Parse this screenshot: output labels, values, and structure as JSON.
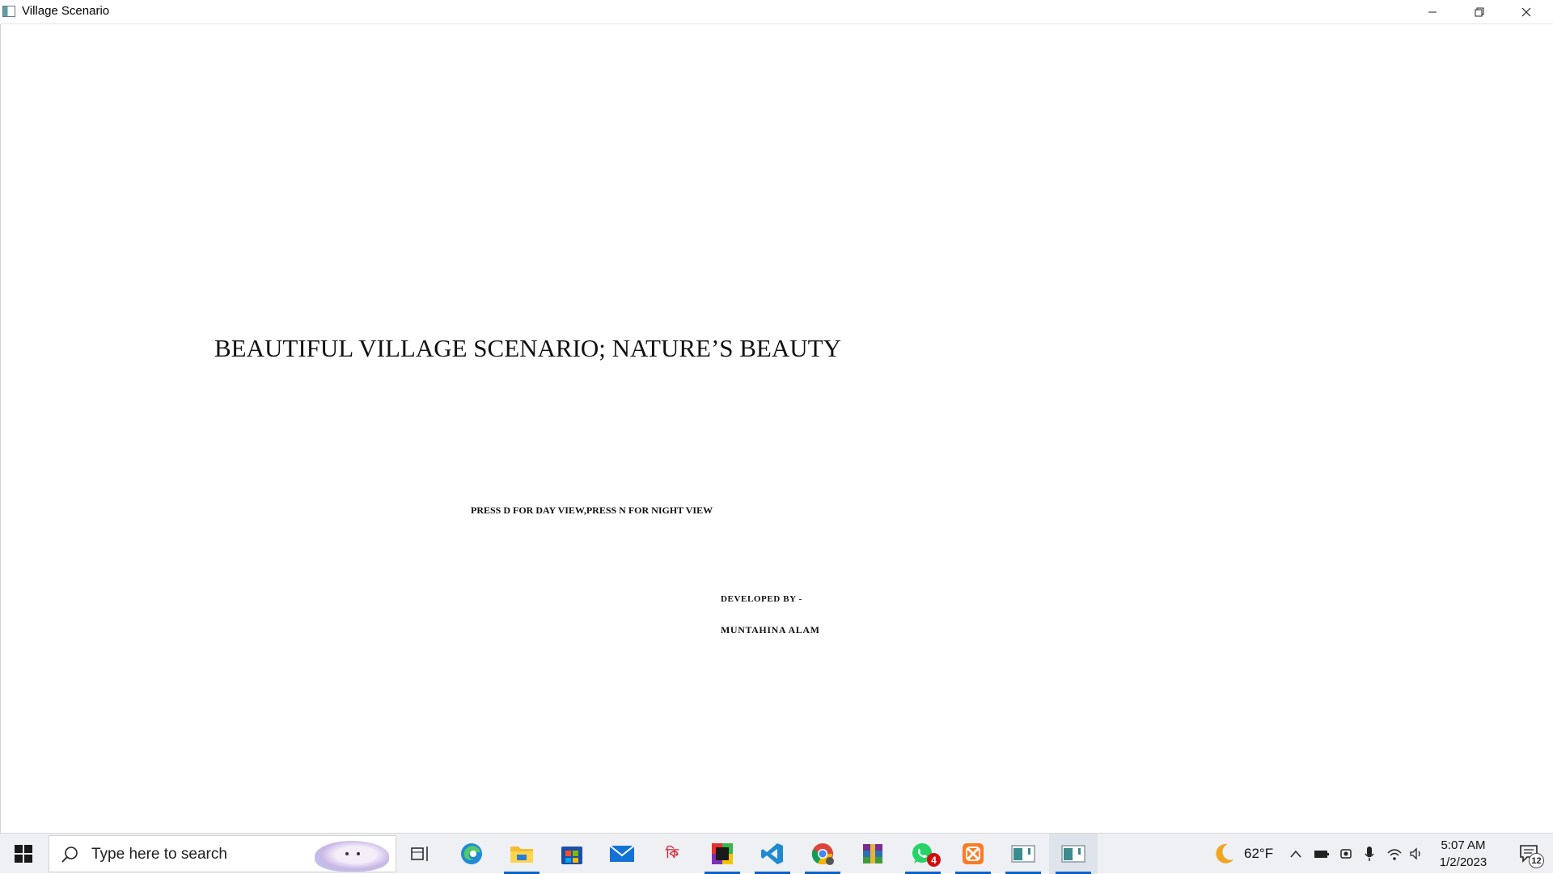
{
  "window": {
    "title": "Village Scenario",
    "icon": "opengl-app-icon"
  },
  "canvas": {
    "main_title": "BEAUTIFUL VILLAGE SCENARIO; NATURE’S BEAUTY",
    "instructions": "PRESS D FOR DAY VIEW,PRESS N FOR NIGHT VIEW",
    "developed_by_label": "DEVELOPED BY -",
    "developer_name": "MUNTAHINA ALAM"
  },
  "taskbar": {
    "search_placeholder": "Type here to search",
    "apps": [
      {
        "name": "task-view",
        "active": false
      },
      {
        "name": "edge",
        "active": false
      },
      {
        "name": "file-explorer",
        "active": true
      },
      {
        "name": "microsoft-store",
        "active": false
      },
      {
        "name": "mail",
        "active": false
      },
      {
        "name": "bengali-app",
        "active": false
      },
      {
        "name": "color-app",
        "active": true
      },
      {
        "name": "vscode",
        "active": true
      },
      {
        "name": "chrome",
        "active": true
      },
      {
        "name": "winrar",
        "active": false
      },
      {
        "name": "whatsapp",
        "active": true,
        "badge": "4"
      },
      {
        "name": "xampp",
        "active": true
      },
      {
        "name": "opengl-window-1",
        "active": true
      },
      {
        "name": "opengl-window-2",
        "active": true
      }
    ],
    "weather_temp": "62°F",
    "clock_time": "5:07 AM",
    "clock_date": "1/2/2023",
    "notification_count": "12"
  },
  "colors": {
    "accent_underline": "#0a64c8",
    "badge_red": "#d10d0d"
  }
}
